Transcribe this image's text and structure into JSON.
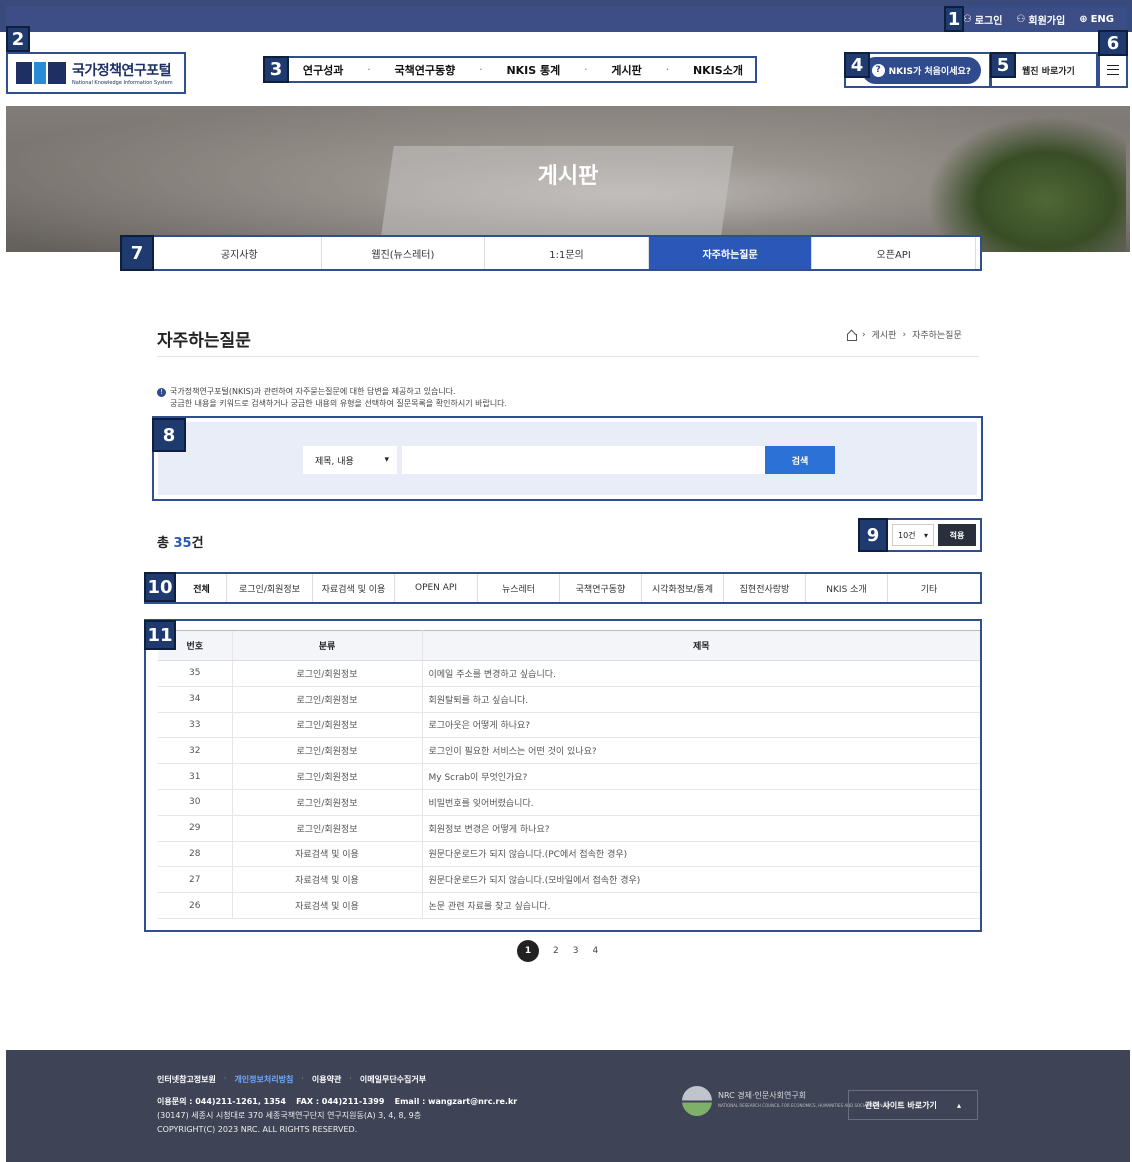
{
  "markers": [
    "1",
    "2",
    "3",
    "4",
    "5",
    "6",
    "7",
    "8",
    "9",
    "10",
    "11"
  ],
  "utility": {
    "login": "로그인",
    "join": "회원가입",
    "lang": "ENG"
  },
  "logo": {
    "ko": "국가정책연구포털",
    "en": "National Knowledge Information System",
    "mark": "NKIS"
  },
  "gnb": [
    {
      "label": "연구성과"
    },
    {
      "label": "국책연구동향"
    },
    {
      "label": "NKIS 통계"
    },
    {
      "label": "게시판"
    },
    {
      "label": "NKIS소개"
    }
  ],
  "gnb_sep": "·",
  "nkis_first": "NKIS가 처음이세요?",
  "webzine_link": "웹진 바로가기",
  "hero_title": "게시판",
  "subtabs": [
    {
      "label": "공지사항"
    },
    {
      "label": "웹진(뉴스레터)"
    },
    {
      "label": "1:1문의"
    },
    {
      "label": "자주하는질문",
      "active": true
    },
    {
      "label": "오픈API"
    }
  ],
  "page_title": "자주하는질문",
  "breadcrumb": [
    "게시판",
    "자주하는질문"
  ],
  "notice": {
    "line1": "국가정책연구포털(NKIS)과 관련하여 자주묻는질문에 대한 답변을 제공하고 있습니다.",
    "line2": "궁금한 내용을 키워드로 검색하거나 궁금한 내용의 유형을 선택하여 질문목록을 확인하시기 바랍니다."
  },
  "search": {
    "field": "제목, 내용",
    "placeholder": "",
    "button": "검색"
  },
  "total": {
    "prefix": "총 ",
    "count": "35",
    "suffix": "건"
  },
  "pagesize": {
    "value": "10건",
    "apply": "적용"
  },
  "categories": [
    "전체",
    "로그인/회원정보",
    "자료검색 및 이용",
    "OPEN API",
    "뉴스레터",
    "국책연구동향",
    "시각화정보/통계",
    "집현전사랑방",
    "NKIS 소개",
    "기타"
  ],
  "table": {
    "headers": [
      "번호",
      "분류",
      "제목"
    ],
    "rows": [
      [
        "35",
        "로그인/회원정보",
        "이메일 주소를 변경하고 싶습니다."
      ],
      [
        "34",
        "로그인/회원정보",
        "회원탈퇴를 하고 싶습니다."
      ],
      [
        "33",
        "로그인/회원정보",
        "로그아웃은 어떻게 하나요?"
      ],
      [
        "32",
        "로그인/회원정보",
        "로그인이 필요한 서비스는 어떤 것이 있나요?"
      ],
      [
        "31",
        "로그인/회원정보",
        "My Scrab이 무엇인가요?"
      ],
      [
        "30",
        "로그인/회원정보",
        "비밀번호를 잊어버렸습니다."
      ],
      [
        "29",
        "로그인/회원정보",
        "회원정보 변경은 어떻게 하나요?"
      ],
      [
        "28",
        "자료검색 및 이용",
        "원문다운로드가 되지 않습니다.(PC에서 접속한 경우)"
      ],
      [
        "27",
        "자료검색 및 이용",
        "원문다운로드가 되지 않습니다.(모바일에서 접속한 경우)"
      ],
      [
        "26",
        "자료검색 및 이용",
        "논문 관련 자료를 찾고 싶습니다."
      ]
    ]
  },
  "pager": [
    "1",
    "2",
    "3",
    "4"
  ],
  "footer": {
    "links": [
      "인터넷참고정보원",
      "개인정보처리방침",
      "이용약관",
      "이메일무단수집거부"
    ],
    "sep": "·",
    "contact_label": "이용문의 : 044)211-1261, 1354",
    "fax": "FAX : 044)211-1399",
    "email": "Email : wangzart@nrc.re.kr",
    "address": "(30147) 세종시 시청대로 370 세종국책연구단지 연구지원동(A) 3, 4, 8, 9층",
    "copyright": "COPYRIGHT(C) 2023 NRC. ALL RIGHTS RESERVED.",
    "nrc_name": "경제·인문사회연구회",
    "nrc_en": "NATIONAL RESEARCH COUNCIL FOR ECONOMICS, HUMANITIES AND SOCIAL SCIENCES",
    "nrc_abbr": "NRC",
    "related": "관련 사이트 바로가기"
  }
}
